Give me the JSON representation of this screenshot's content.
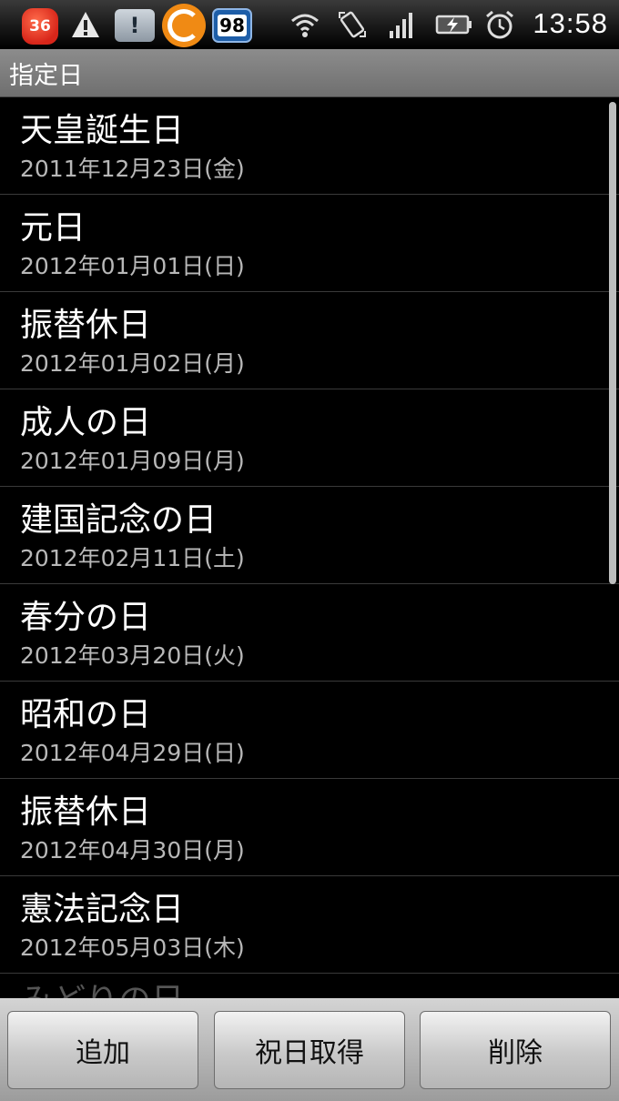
{
  "status_bar": {
    "notification_count": "36",
    "badge_number": "98",
    "chat_glyph": "!",
    "time": "13:58",
    "icons": [
      "warning-icon",
      "chat-bubble-icon",
      "orange-app-icon",
      "wifi-icon",
      "rotate-icon",
      "signal-icon",
      "battery-charging-icon",
      "alarm-icon"
    ],
    "colors": {
      "badge_red": "#d8261a",
      "orange": "#f08a14",
      "blue": "#1e5ea8"
    }
  },
  "title_bar": {
    "title": "指定日"
  },
  "list": {
    "items": [
      {
        "name": "天皇誕生日",
        "date": "2011年12月23日(金)"
      },
      {
        "name": "元日",
        "date": "2012年01月01日(日)"
      },
      {
        "name": "振替休日",
        "date": "2012年01月02日(月)"
      },
      {
        "name": "成人の日",
        "date": "2012年01月09日(月)"
      },
      {
        "name": "建国記念の日",
        "date": "2012年02月11日(土)"
      },
      {
        "name": "春分の日",
        "date": "2012年03月20日(火)"
      },
      {
        "name": "昭和の日",
        "date": "2012年04月29日(日)"
      },
      {
        "name": "振替休日",
        "date": "2012年04月30日(月)"
      },
      {
        "name": "憲法記念日",
        "date": "2012年05月03日(木)"
      },
      {
        "name": "みどりの日",
        "date": ""
      }
    ]
  },
  "bottom_bar": {
    "add_label": "追加",
    "fetch_holidays_label": "祝日取得",
    "delete_label": "削除"
  }
}
